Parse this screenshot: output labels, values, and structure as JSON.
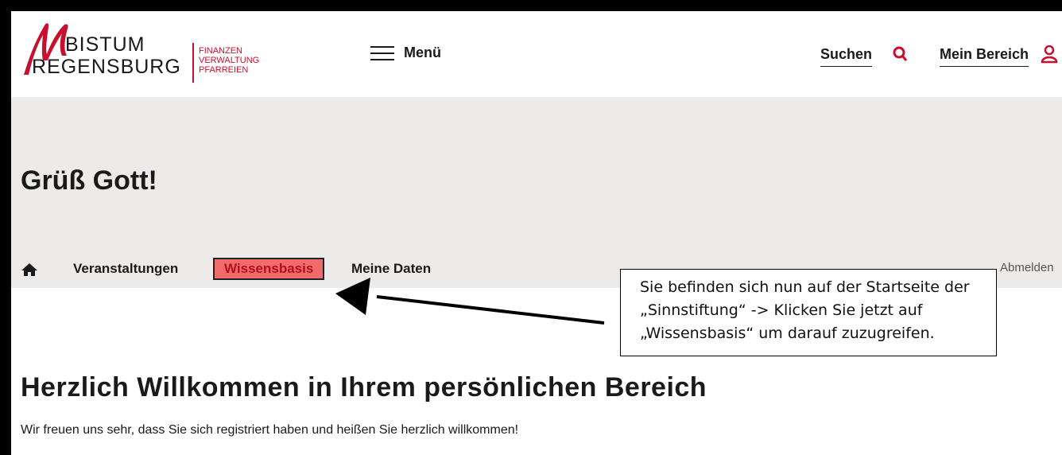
{
  "header": {
    "logo": {
      "line1": "BISTUM",
      "line2": "REGENSBURG",
      "subtitle": [
        "FINANZEN",
        "VERWALTUNG",
        "PFARREIEN"
      ]
    },
    "menu_label": "Menü",
    "search_label": "Suchen",
    "account_label": "Mein Bereich"
  },
  "hero": {
    "title": "Grüß Gott!"
  },
  "nav": {
    "items": [
      {
        "label": "Veranstaltungen"
      },
      {
        "label": "Wissensbasis"
      },
      {
        "label": "Meine Daten"
      }
    ],
    "logout_label": "Abmelden"
  },
  "callout": {
    "lines": [
      "Sie befinden sich nun auf der Startseite der",
      "„Sinnstiftung“ -> Klicken Sie jetzt auf",
      "„Wissensbasis“ um darauf zuzugreifen."
    ]
  },
  "main": {
    "title": "Herzlich Willkommen in Ihrem persönlichen Bereich",
    "text": "Wir freuen uns sehr, dass Sie sich registriert haben und heißen Sie herzlich willkommen!"
  },
  "colors": {
    "brand_red": "#c8102e",
    "hero_bg": "#edebe9",
    "active_tab_bg": "#f26b6b"
  },
  "icons": [
    "hamburger-icon",
    "search-icon",
    "user-icon",
    "home-icon",
    "arrow-pointer"
  ]
}
